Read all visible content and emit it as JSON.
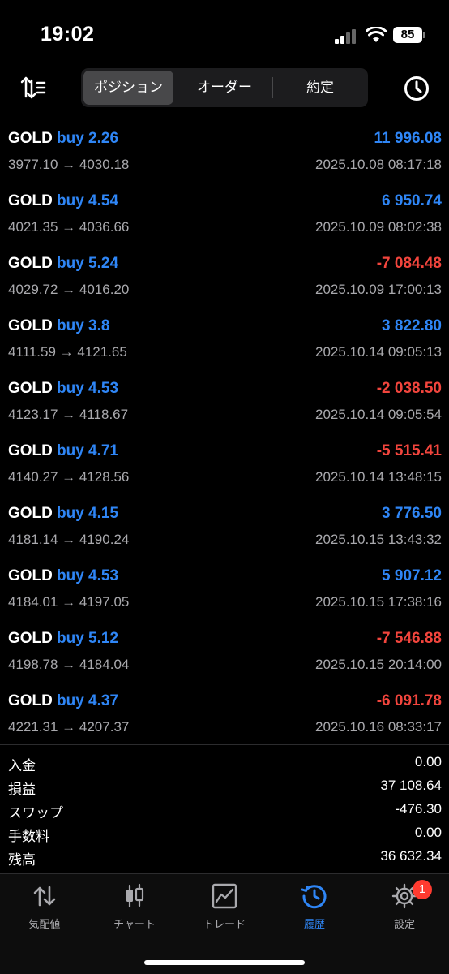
{
  "status_bar": {
    "time": "19:02",
    "battery": "85"
  },
  "header": {
    "tabs": [
      {
        "label": "ポジション",
        "active": true
      },
      {
        "label": "オーダー",
        "active": false
      },
      {
        "label": "約定",
        "active": false
      }
    ]
  },
  "colors": {
    "profit": "#2f86f6",
    "loss": "#f2453d",
    "accent": "#2f86f6"
  },
  "trades": [
    {
      "symbol": "GOLD",
      "side": "buy 2.26",
      "prices": "3977.10 → 4030.18",
      "profit": "11 996.08",
      "date": "2025.10.08 08:17:18",
      "positive": true
    },
    {
      "symbol": "GOLD",
      "side": "buy 4.54",
      "prices": "4021.35 → 4036.66",
      "profit": "6 950.74",
      "date": "2025.10.09 08:02:38",
      "positive": true
    },
    {
      "symbol": "GOLD",
      "side": "buy 5.24",
      "prices": "4029.72 → 4016.20",
      "profit": "-7 084.48",
      "date": "2025.10.09 17:00:13",
      "positive": false
    },
    {
      "symbol": "GOLD",
      "side": "buy 3.8",
      "prices": "4111.59 → 4121.65",
      "profit": "3 822.80",
      "date": "2025.10.14 09:05:13",
      "positive": true
    },
    {
      "symbol": "GOLD",
      "side": "buy 4.53",
      "prices": "4123.17 → 4118.67",
      "profit": "-2 038.50",
      "date": "2025.10.14 09:05:54",
      "positive": false
    },
    {
      "symbol": "GOLD",
      "side": "buy 4.71",
      "prices": "4140.27 → 4128.56",
      "profit": "-5 515.41",
      "date": "2025.10.14 13:48:15",
      "positive": false
    },
    {
      "symbol": "GOLD",
      "side": "buy 4.15",
      "prices": "4181.14 → 4190.24",
      "profit": "3 776.50",
      "date": "2025.10.15 13:43:32",
      "positive": true
    },
    {
      "symbol": "GOLD",
      "side": "buy 4.53",
      "prices": "4184.01 → 4197.05",
      "profit": "5 907.12",
      "date": "2025.10.15 17:38:16",
      "positive": true
    },
    {
      "symbol": "GOLD",
      "side": "buy 5.12",
      "prices": "4198.78 → 4184.04",
      "profit": "-7 546.88",
      "date": "2025.10.15 20:14:00",
      "positive": false
    },
    {
      "symbol": "GOLD",
      "side": "buy 4.37",
      "prices": "4221.31 → 4207.37",
      "profit": "-6 091.78",
      "date": "2025.10.16 08:33:17",
      "positive": false
    }
  ],
  "summary": [
    {
      "label": "入金",
      "value": "0.00"
    },
    {
      "label": "損益",
      "value": "37 108.64"
    },
    {
      "label": "スワップ",
      "value": "-476.30"
    },
    {
      "label": "手数料",
      "value": "0.00"
    },
    {
      "label": "残高",
      "value": "36 632.34"
    }
  ],
  "tab_bar": {
    "items": [
      {
        "label": "気配値",
        "icon": "quotes-icon",
        "active": false
      },
      {
        "label": "チャート",
        "icon": "chart-icon",
        "active": false
      },
      {
        "label": "トレード",
        "icon": "trade-icon",
        "active": false
      },
      {
        "label": "履歴",
        "icon": "history-icon",
        "active": true
      },
      {
        "label": "設定",
        "icon": "settings-icon",
        "active": false
      }
    ],
    "settings_badge": "1"
  }
}
